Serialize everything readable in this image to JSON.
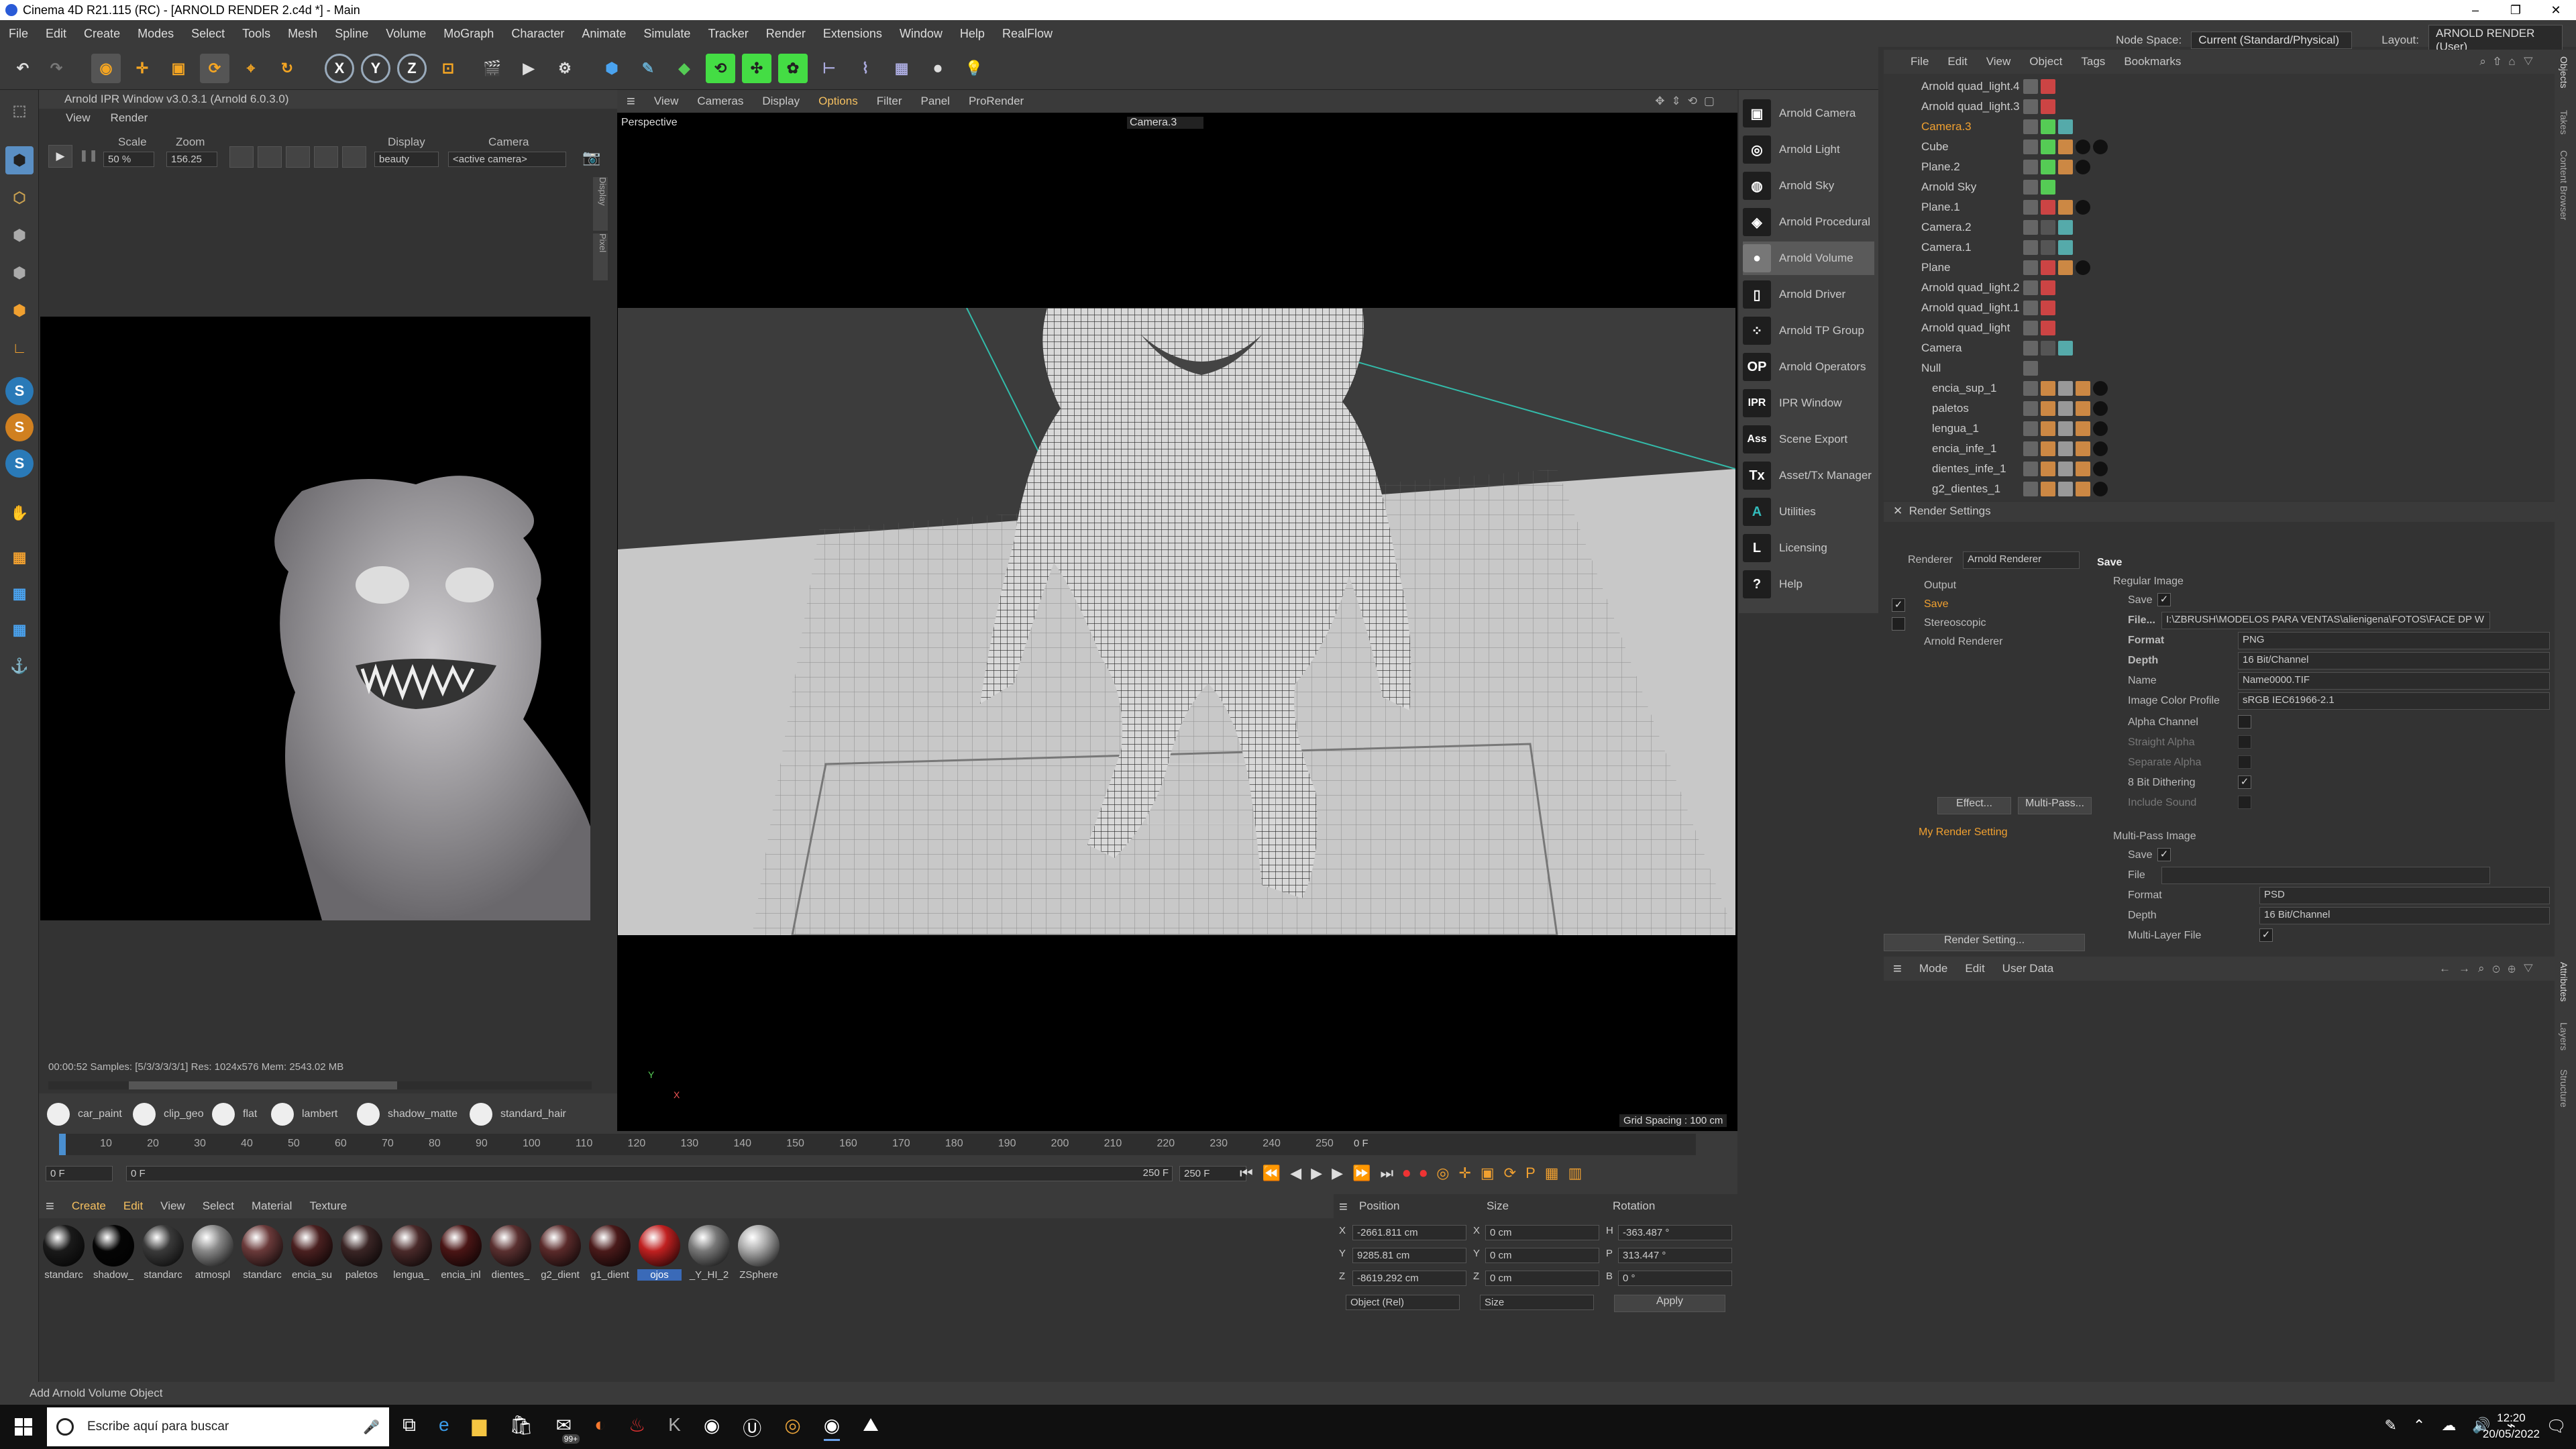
{
  "window": {
    "title": "Cinema 4D R21.115 (RC) - [ARNOLD RENDER 2.c4d *] - Main"
  },
  "menu": {
    "items": [
      "File",
      "Edit",
      "Create",
      "Modes",
      "Select",
      "Tools",
      "Mesh",
      "Spline",
      "Volume",
      "MoGraph",
      "Character",
      "Animate",
      "Simulate",
      "Tracker",
      "Render",
      "Extensions",
      "Window",
      "Help",
      "RealFlow"
    ],
    "node_space_label": "Node Space:",
    "node_space_value": "Current (Standard/Physical)",
    "layout_label": "Layout:",
    "layout_value": "ARNOLD RENDER (User)"
  },
  "ipr": {
    "title": "Arnold IPR Window v3.0.3.1 (Arnold 6.0.3.0)",
    "menu": [
      "View",
      "Render"
    ],
    "scale_label": "Scale",
    "scale_value": "50 %",
    "zoom_label": "Zoom",
    "zoom_value": "156.25",
    "display_label": "Display",
    "display_value": "beauty",
    "camera_label": "Camera",
    "camera_value": "<active camera>",
    "status": "00:00:52  Samples: [5/3/3/3/3/1]  Res: 1024x576  Mem: 2543.02 MB",
    "side_tabs": [
      "Display",
      "Pixel"
    ]
  },
  "shaders": [
    "car_paint",
    "clip_geo",
    "flat",
    "lambert",
    "shadow_matte",
    "standard_hair"
  ],
  "viewport": {
    "menu": [
      "View",
      "Cameras",
      "Display",
      "Options",
      "Filter",
      "Panel",
      "ProRender"
    ],
    "name": "Perspective",
    "camera": "Camera.3",
    "grid": "Grid Spacing : 100 cm",
    "axis_y": "Y",
    "axis_x": "X"
  },
  "arnold_menu": [
    {
      "icon": "camera-icon",
      "label": "Arnold Camera",
      "glyph": "▣"
    },
    {
      "icon": "light-icon",
      "label": "Arnold Light",
      "glyph": "◎"
    },
    {
      "icon": "sky-icon",
      "label": "Arnold Sky",
      "glyph": "◍"
    },
    {
      "icon": "procedural-icon",
      "label": "Arnold Procedural",
      "glyph": "◈"
    },
    {
      "icon": "volume-icon",
      "label": "Arnold Volume",
      "glyph": "●"
    },
    {
      "icon": "driver-icon",
      "label": "Arnold Driver",
      "glyph": "▯"
    },
    {
      "icon": "tp-group-icon",
      "label": "Arnold TP Group",
      "glyph": "⁘"
    },
    {
      "icon": "operators-icon",
      "label": "Arnold Operators",
      "glyph": "OP"
    },
    {
      "icon": "ipr-icon",
      "label": "IPR Window",
      "glyph": "IPR"
    },
    {
      "icon": "ass-icon",
      "label": "Scene Export",
      "glyph": "Ass"
    },
    {
      "icon": "tx-icon",
      "label": "Asset/Tx Manager",
      "glyph": "Tx"
    },
    {
      "icon": "utilities-icon",
      "label": "Utilities",
      "glyph": "A"
    },
    {
      "icon": "licensing-icon",
      "label": "Licensing",
      "glyph": "L"
    },
    {
      "icon": "help-icon",
      "label": "Help",
      "glyph": "?"
    }
  ],
  "object_manager": {
    "menu": [
      "File",
      "Edit",
      "View",
      "Object",
      "Tags",
      "Bookmarks"
    ],
    "objects": [
      "Arnold quad_light.4",
      "Arnold quad_light.3",
      "Camera.3",
      "Cube",
      "Plane.2",
      "Arnold Sky",
      "Plane.1",
      "Camera.2",
      "Camera.1",
      "Plane",
      "Arnold quad_light.2",
      "Arnold quad_light.1",
      "Arnold quad_light",
      "Camera",
      "Null",
      "encia_sup_1",
      "paletos",
      "lengua_1",
      "encia_infe_1",
      "dientes_infe_1",
      "g2_dientes_1"
    ]
  },
  "render_settings": {
    "title": "Render Settings",
    "renderer_label": "Renderer",
    "renderer_value": "Arnold Renderer",
    "tree": [
      "Output",
      "Save",
      "Stereoscopic",
      "Arnold Renderer"
    ],
    "effect_btn": "Effect...",
    "multipass_btn": "Multi-Pass...",
    "my_setting": "My Render Setting",
    "render_setting_btn": "Render Setting...",
    "save_header": "Save",
    "regular_image": "Regular Image",
    "save_label": "Save",
    "file_label": "File...",
    "file_value": "I:\\ZBRUSH\\MODELOS PARA VENTAS\\alienigena\\FOTOS\\FACE DP W",
    "format_label": "Format",
    "format_value": "PNG",
    "depth_label": "Depth",
    "depth_value": "16 Bit/Channel",
    "name_label": "Name",
    "name_value": "Name0000.TIF",
    "profile_label": "Image Color Profile",
    "profile_value": "sRGB IEC61966-2.1",
    "alpha_label": "Alpha Channel",
    "straight_label": "Straight Alpha",
    "separate_label": "Separate Alpha",
    "dither_label": "8 Bit Dithering",
    "sound_label": "Include Sound",
    "multipass_header": "Multi-Pass Image",
    "mp_save": "Save",
    "mp_file": "File",
    "mp_format": "Format",
    "mp_format_value": "PSD",
    "mp_depth": "Depth",
    "mp_depth_value": "16 Bit/Channel",
    "mp_multilayer": "Multi-Layer File"
  },
  "attributes": {
    "menu": [
      "Mode",
      "Edit",
      "User Data"
    ]
  },
  "right_tabs": [
    "Objects",
    "Takes",
    "Content Browser",
    "Attributes",
    "Layers",
    "Structure"
  ],
  "timeline": {
    "ticks": [
      "0",
      "10",
      "20",
      "30",
      "40",
      "50",
      "60",
      "70",
      "80",
      "90",
      "100",
      "110",
      "120",
      "130",
      "140",
      "150",
      "160",
      "170",
      "180",
      "190",
      "200",
      "210",
      "220",
      "230",
      "240",
      "250"
    ],
    "frame_end": "0 F",
    "start": "0 F",
    "start2": "0 F",
    "end": "250 F",
    "end2": "250 F"
  },
  "material_manager": {
    "menu": [
      "Create",
      "Edit",
      "View",
      "Select",
      "Material",
      "Texture"
    ],
    "materials": [
      {
        "name": "standarc",
        "color": "#1a1a1a"
      },
      {
        "name": "shadow_",
        "color": "#050505"
      },
      {
        "name": "standarc",
        "color": "#3a3a3a"
      },
      {
        "name": "atmospl",
        "color": "#888"
      },
      {
        "name": "standarc",
        "color": "#6a3a3a"
      },
      {
        "name": "encia_su",
        "color": "#4a2020"
      },
      {
        "name": "paletos",
        "color": "#3a2525"
      },
      {
        "name": "lengua_",
        "color": "#4a2a2a"
      },
      {
        "name": "encia_inl",
        "color": "#4a1515"
      },
      {
        "name": "dientes_",
        "color": "#5a3030"
      },
      {
        "name": "g2_dient",
        "color": "#5a2a2a"
      },
      {
        "name": "g1_dient",
        "color": "#4a1a1a"
      },
      {
        "name": "ojos",
        "color": "#c02020"
      },
      {
        "name": "_Y_HI_2",
        "color": "#777"
      },
      {
        "name": "ZSphere",
        "color": "#aaa"
      }
    ]
  },
  "coordinates": {
    "position_label": "Position",
    "size_label": "Size",
    "rotation_label": "Rotation",
    "rows": [
      {
        "axis": "X",
        "pos": "-2661.811 cm",
        "saxis": "X",
        "size": "0 cm",
        "raxis": "H",
        "rot": "-363.487 °"
      },
      {
        "axis": "Y",
        "pos": "9285.81 cm",
        "saxis": "Y",
        "size": "0 cm",
        "raxis": "P",
        "rot": "313.447 °"
      },
      {
        "axis": "Z",
        "pos": "-8619.292 cm",
        "saxis": "Z",
        "size": "0 cm",
        "raxis": "B",
        "rot": "0 °"
      }
    ],
    "mode": "Object (Rel)",
    "size_mode": "Size",
    "apply": "Apply"
  },
  "status": "Add Arnold Volume Object",
  "taskbar": {
    "search_placeholder": "Escribe aquí para buscar",
    "time": "12:20",
    "date": "20/05/2022",
    "badge": "99+"
  }
}
